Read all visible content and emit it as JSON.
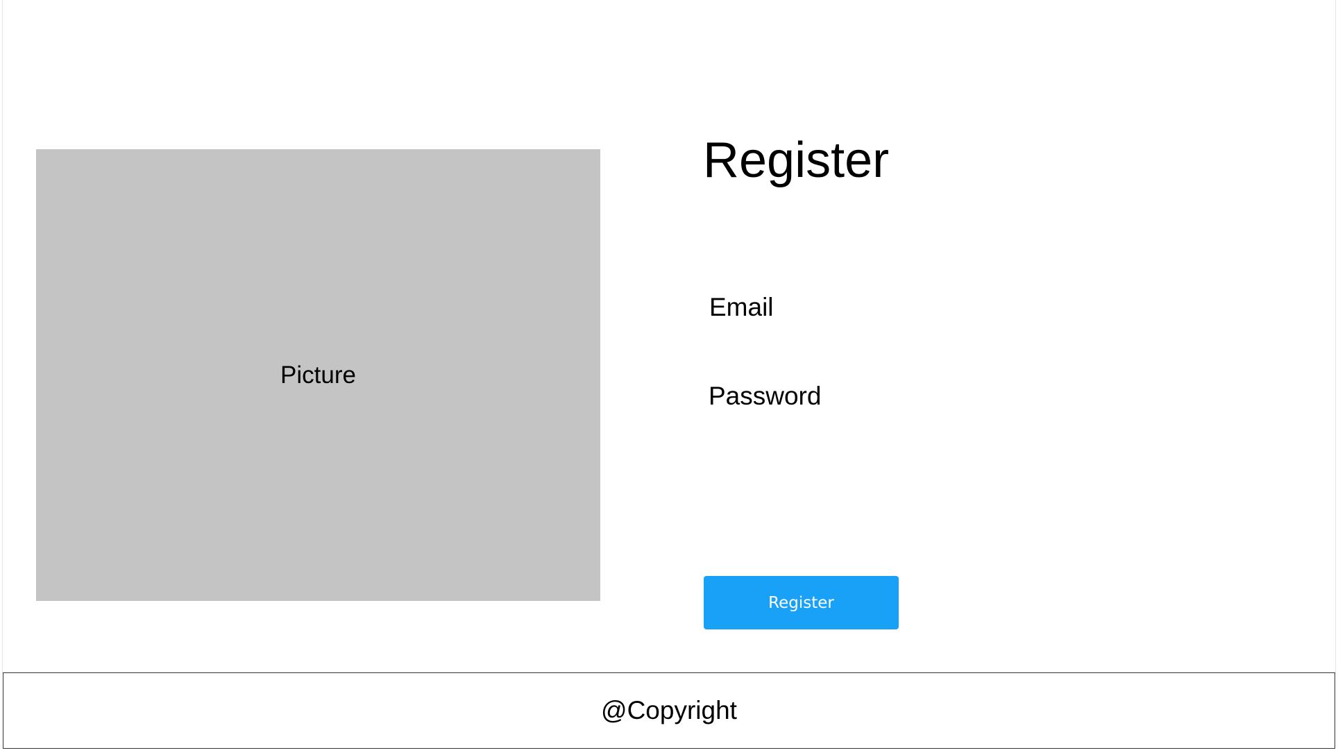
{
  "picture": {
    "label": "Picture",
    "fill_color": "#c4c4c4"
  },
  "form": {
    "title": "Register",
    "email_label": "Email",
    "email_value": "",
    "password_label": "Password",
    "password_value": "",
    "submit_label": "Register",
    "submit_color": "#18a1f7"
  },
  "footer": {
    "text": "@Copyright"
  }
}
